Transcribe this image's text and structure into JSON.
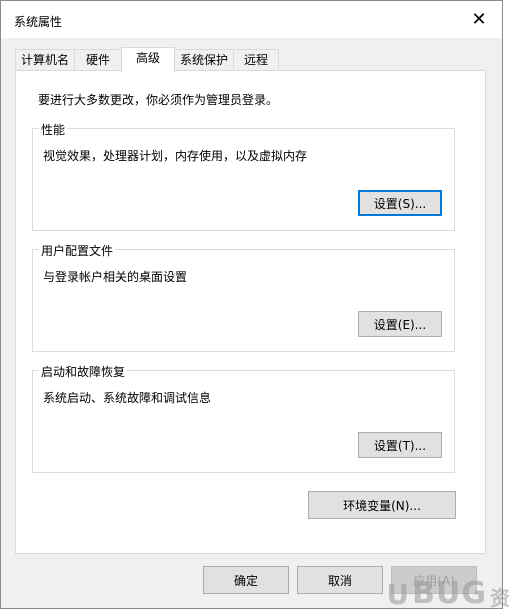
{
  "window": {
    "title": "系统属性",
    "close_glyph": "✕"
  },
  "tabs": [
    {
      "label": "计算机名",
      "active": false
    },
    {
      "label": "硬件",
      "active": false
    },
    {
      "label": "高级",
      "active": true
    },
    {
      "label": "系统保护",
      "active": false
    },
    {
      "label": "远程",
      "active": false
    }
  ],
  "advanced": {
    "admin_note": "要进行大多数更改，你必须作为管理员登录。",
    "performance": {
      "title": "性能",
      "description": "视觉效果，处理器计划，内存使用，以及虚拟内存",
      "button": "设置(S)..."
    },
    "user_profiles": {
      "title": "用户配置文件",
      "description": "与登录帐户相关的桌面设置",
      "button": "设置(E)..."
    },
    "startup_recovery": {
      "title": "启动和故障恢复",
      "description": "系统启动、系统故障和调试信息",
      "button": "设置(T)..."
    },
    "env_button": "环境变量(N)..."
  },
  "footer": {
    "ok": "确定",
    "cancel": "取消",
    "apply": "应用(A)"
  },
  "watermark": {
    "u": "U",
    "bug": "BUG",
    "cn": "资"
  },
  "colors": {
    "focus": "#0078d7",
    "button_bg": "#e1e1e1",
    "dialog_bg": "#f0f0f0"
  }
}
